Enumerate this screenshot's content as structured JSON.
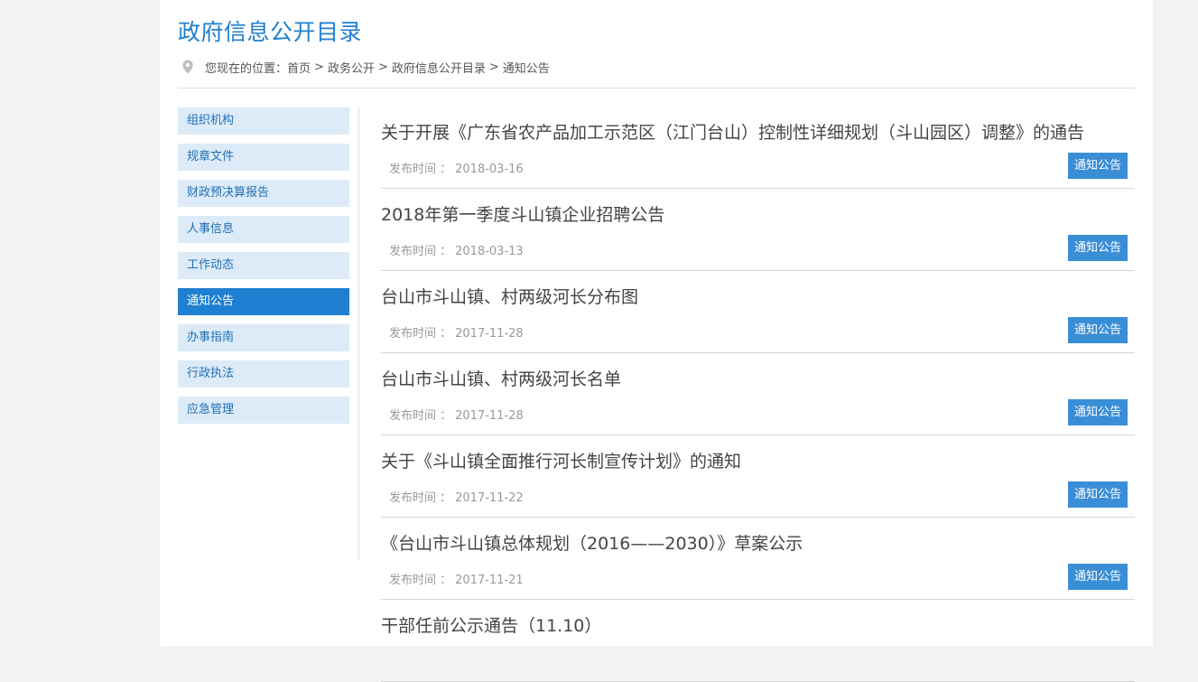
{
  "header": {
    "title": "政府信息公开目录",
    "breadcrumb_prefix": "您现在的位置：",
    "breadcrumb": [
      "首页",
      "政务公开",
      "政府信息公开目录",
      "通知公告"
    ],
    "separator": ">"
  },
  "sidebar": {
    "items": [
      {
        "label": "组织机构",
        "active": false
      },
      {
        "label": "规章文件",
        "active": false
      },
      {
        "label": "财政预决算报告",
        "active": false
      },
      {
        "label": "人事信息",
        "active": false
      },
      {
        "label": "工作动态",
        "active": false
      },
      {
        "label": "通知公告",
        "active": true
      },
      {
        "label": "办事指南",
        "active": false
      },
      {
        "label": "行政执法",
        "active": false
      },
      {
        "label": "应急管理",
        "active": false
      }
    ]
  },
  "list": {
    "meta_label": "发布时间 ：",
    "items": [
      {
        "title": "关于开展《广东省农产品加工示范区（江门台山）控制性详细规划（斗山园区）调整》的通告",
        "date": "2018-03-16",
        "tag": "通知公告"
      },
      {
        "title": "2018年第一季度斗山镇企业招聘公告",
        "date": "2018-03-13",
        "tag": "通知公告"
      },
      {
        "title": "台山市斗山镇、村两级河长分布图",
        "date": "2017-11-28",
        "tag": "通知公告"
      },
      {
        "title": "台山市斗山镇、村两级河长名单",
        "date": "2017-11-28",
        "tag": "通知公告"
      },
      {
        "title": "关于《斗山镇全面推行河长制宣传计划》的通知",
        "date": "2017-11-22",
        "tag": "通知公告"
      },
      {
        "title": "《台山市斗山镇总体规划（2016——2030）》草案公示",
        "date": "2017-11-21",
        "tag": "通知公告"
      },
      {
        "title": "干部任前公示通告（11.10）",
        "date": "",
        "tag": ""
      }
    ]
  },
  "colors": {
    "accent": "#1f7fd0",
    "sidebar_bg": "#dcebf7",
    "tag_bg": "#3a8ed6"
  },
  "icons": {
    "breadcrumb": "map-pin-icon"
  }
}
